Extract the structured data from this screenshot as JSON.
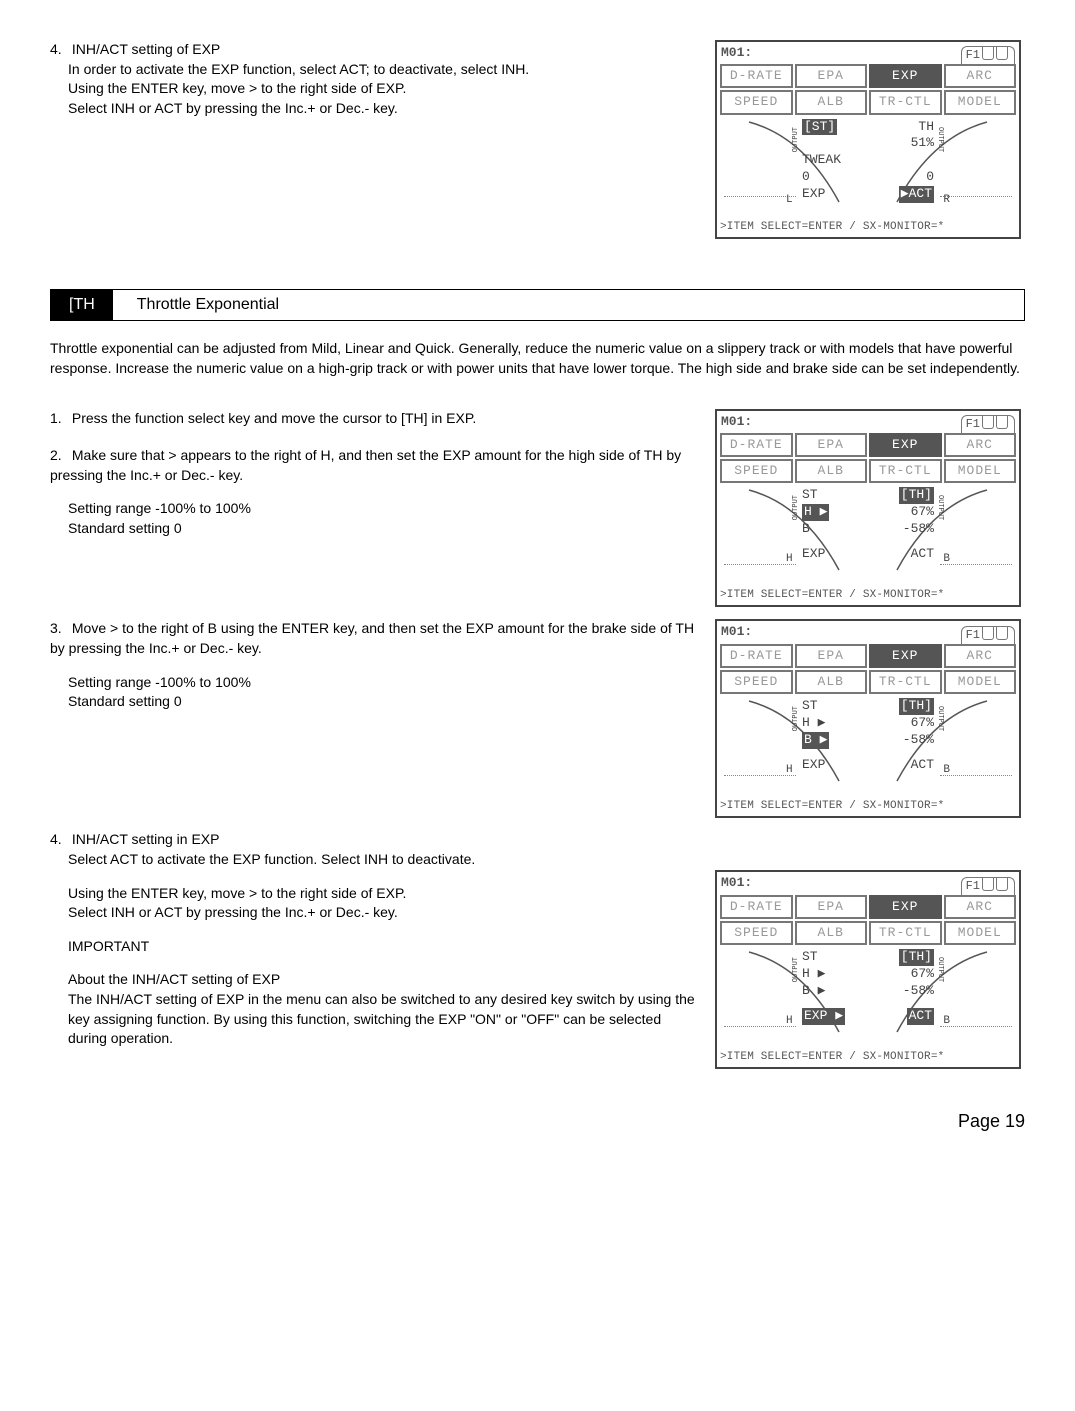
{
  "top": {
    "num": "4.",
    "heading": "INH/ACT setting of EXP",
    "line1": "In order to activate the EXP function, select ACT; to deactivate, select INH.",
    "line2": "Using the ENTER key, move > to the right side of EXP.",
    "line3": "Select INH or ACT by pressing the Inc.+ or Dec.- key."
  },
  "section": {
    "code": "[TH",
    "title": "Throttle Exponential"
  },
  "intro": "Throttle exponential can be adjusted from Mild, Linear and Quick. Generally, reduce the numeric value on a slippery track or with models that have powerful response.  Increase the numeric value on a high-grip track or with power units that have lower torque.  The high side and brake side can be set independently.",
  "step1": {
    "num": "1.",
    "text": "Press the function select key and move the cursor to [TH] in EXP."
  },
  "step2": {
    "num": "2.",
    "text": "Make sure that > appears to the right of H, and then set the EXP amount for the high side of TH by pressing the Inc.+ or Dec.- key.",
    "range": "Setting range -100% to 100%",
    "std": "Standard setting 0"
  },
  "step3": {
    "num": "3.",
    "text": "Move > to the right of B using the ENTER key, and then set the EXP amount for the brake side of TH by pressing the Inc.+ or Dec.- key.",
    "range": "Setting range -100% to 100%",
    "std": "Standard setting  0"
  },
  "step4": {
    "num": "4.",
    "heading": "INH/ACT setting in EXP",
    "line1": "Select ACT to activate the EXP function.  Select INH to deactivate.",
    "line2": "Using the ENTER key, move > to the right side of EXP.",
    "line3": "Select INH or ACT by pressing the Inc.+ or Dec.- key.",
    "imp": "IMPORTANT",
    "about_h": "About the INH/ACT setting of EXP",
    "about": "The INH/ACT setting of EXP in the menu can also be switched to any desired key switch by using the key assigning function. By using this function, switching the EXP \"ON\" or \"OFF\" can be selected during operation."
  },
  "lcd_tabs1": [
    "D-RATE",
    "EPA",
    "EXP",
    "ARC"
  ],
  "lcd_tabs2": [
    "SPEED",
    "ALB",
    "TR-CTL",
    "MODEL"
  ],
  "lcd_model": "M01:",
  "lcd_f1": "F1",
  "lcd_status": ">ITEM SELECT=ENTER / SX-MONITOR=*",
  "lcdA": {
    "r1l": "[ST]",
    "r1r": "TH",
    "r2l": "",
    "r2r": "51%",
    "r3l": "TWEAK",
    "r3r": "",
    "r4l": "0",
    "r4r": "0",
    "lbl_l": "L",
    "exp": "EXP",
    "act": "▶ACT",
    "lbl_r": "R"
  },
  "lcdB": {
    "r1l": "ST",
    "r1r": "[TH]",
    "r2l": "H ▶",
    "r2r": "67%",
    "r3l": "B",
    "r3r": "-58%",
    "exp": "EXP",
    "act": "ACT",
    "lbl_l": "H",
    "lbl_r": "B"
  },
  "lcdC": {
    "r1l": "ST",
    "r1r": "[TH]",
    "r2l": "H ▶",
    "r2r": "67%",
    "r3l": "B ▶",
    "r3r": "-58%",
    "exp": "EXP",
    "act": "ACT",
    "lbl_l": "H",
    "lbl_r": "B"
  },
  "lcdD": {
    "r1l": "ST",
    "r1r": "[TH]",
    "r2l": "H ▶",
    "r2r": "67%",
    "r3l": "B ▶",
    "r3r": "-58%",
    "exp": "EXP ▶",
    "act": "ACT",
    "lbl_l": "H",
    "lbl_r": "B"
  },
  "side_lbl": "OUTPUT",
  "page": "Page 19"
}
